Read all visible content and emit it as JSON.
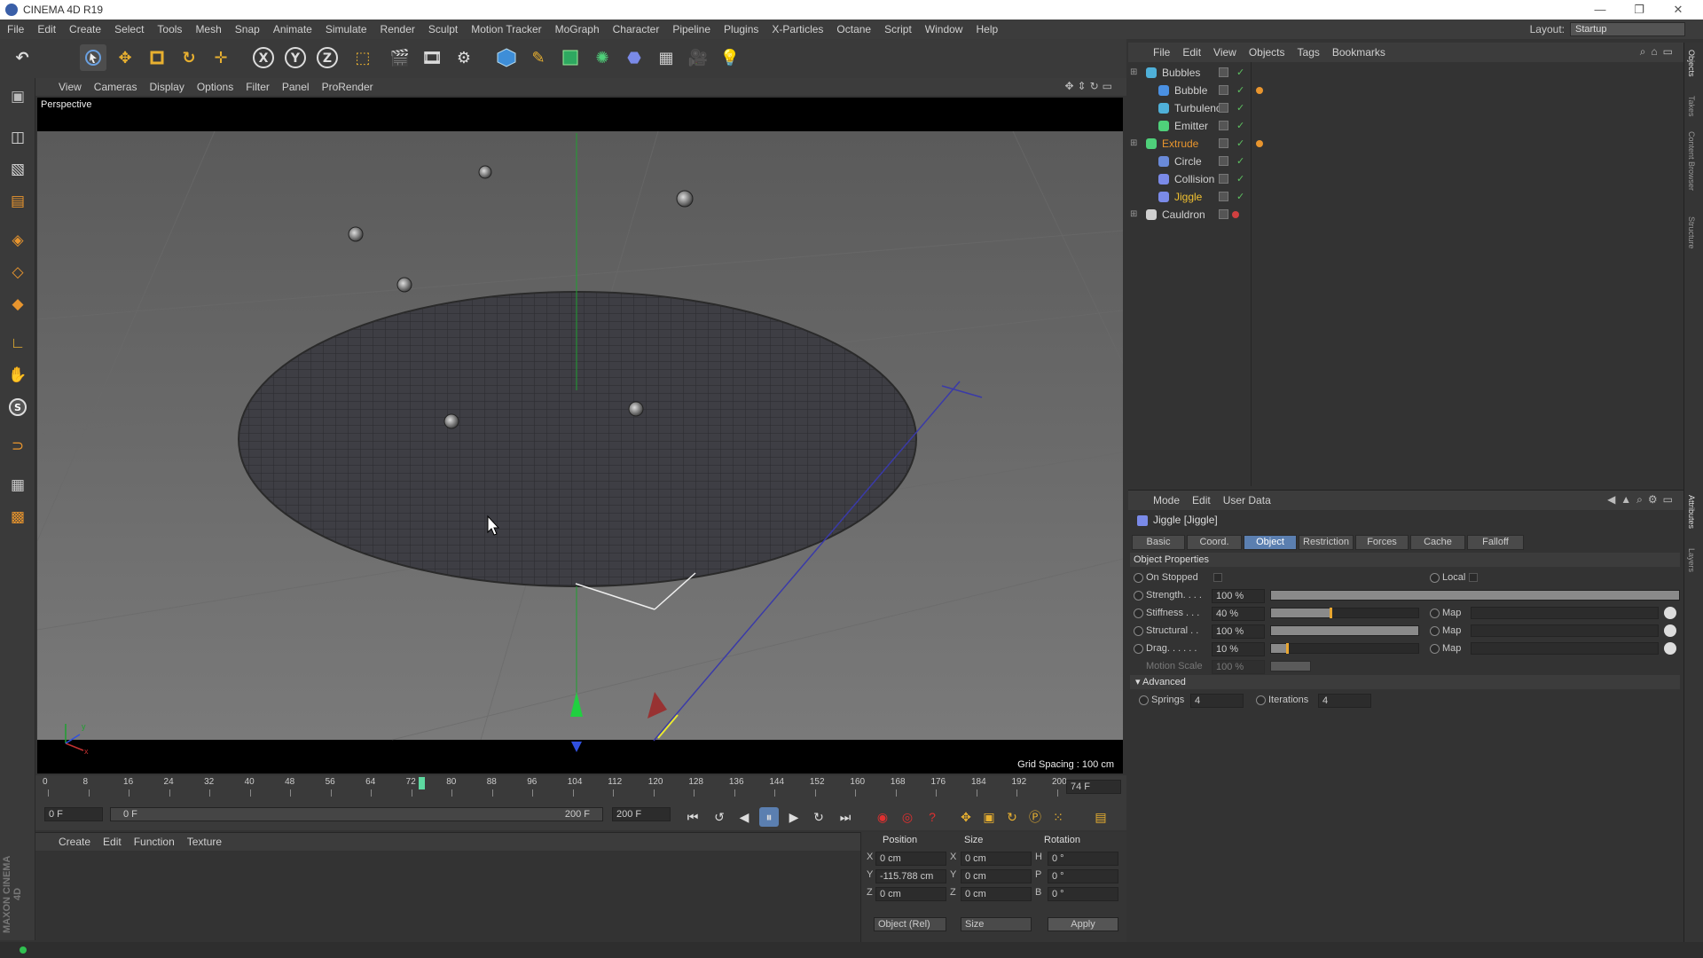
{
  "app": {
    "title": "CINEMA 4D R19",
    "window_controls": [
      "—",
      "❐",
      "✕"
    ]
  },
  "menubar": {
    "items": [
      "File",
      "Edit",
      "Create",
      "Select",
      "Tools",
      "Mesh",
      "Snap",
      "Animate",
      "Simulate",
      "Render",
      "Sculpt",
      "Motion Tracker",
      "MoGraph",
      "Character",
      "Pipeline",
      "Plugins",
      "X-Particles",
      "Octane",
      "Script",
      "Window",
      "Help"
    ],
    "layout_label": "Layout:",
    "layout_value": "Startup"
  },
  "viewport": {
    "menu": [
      "View",
      "Cameras",
      "Display",
      "Options",
      "Filter",
      "Panel",
      "ProRender"
    ],
    "label": "Perspective",
    "grid_spacing": "Grid Spacing : 100 cm",
    "axis_x": "x",
    "axis_y": "y"
  },
  "timeline": {
    "ticks": [
      "0",
      "8",
      "16",
      "24",
      "32",
      "40",
      "48",
      "56",
      "64",
      "72",
      "80",
      "88",
      "96",
      "104",
      "112",
      "120",
      "128",
      "136",
      "144",
      "152",
      "160",
      "168",
      "176",
      "184",
      "192",
      "200"
    ],
    "current_frame": "74 F",
    "start_field": "0 F",
    "range_start": "0 F",
    "range_end": "200 F",
    "end_field": "200 F"
  },
  "material_manager": {
    "menu": [
      "Create",
      "Edit",
      "Function",
      "Texture"
    ]
  },
  "coordinates": {
    "headers": [
      "Position",
      "Size",
      "Rotation"
    ],
    "rows": [
      {
        "axis": "X",
        "pos": "0 cm",
        "size_axis": "X",
        "size": "0 cm",
        "rot_axis": "H",
        "rot": "0 °"
      },
      {
        "axis": "Y",
        "pos": "-115.788 cm",
        "size_axis": "Y",
        "size": "0 cm",
        "rot_axis": "P",
        "rot": "0 °"
      },
      {
        "axis": "Z",
        "pos": "0 cm",
        "size_axis": "Z",
        "size": "0 cm",
        "rot_axis": "B",
        "rot": "0 °"
      }
    ],
    "mode_select": "Object (Rel)",
    "size_select": "Size",
    "apply_label": "Apply"
  },
  "object_manager": {
    "menu": [
      "File",
      "Edit",
      "View",
      "Objects",
      "Tags",
      "Bookmarks"
    ],
    "objects": [
      {
        "name": "Bubbles",
        "indent": 0,
        "color": "#d0d0d0",
        "icon_color": "#4fb0d8"
      },
      {
        "name": "Bubble",
        "indent": 1,
        "color": "#d0d0d0",
        "icon_color": "#4a90e2"
      },
      {
        "name": "Turbulence",
        "indent": 1,
        "color": "#d0d0d0",
        "icon_color": "#4fb0d8"
      },
      {
        "name": "Emitter",
        "indent": 1,
        "color": "#d0d0d0",
        "icon_color": "#4fd07a"
      },
      {
        "name": "Extrude",
        "indent": 0,
        "color": "#e8952e",
        "icon_color": "#4fd07a"
      },
      {
        "name": "Circle",
        "indent": 1,
        "color": "#d0d0d0",
        "icon_color": "#6a8ad8"
      },
      {
        "name": "Collision",
        "indent": 1,
        "color": "#d0d0d0",
        "icon_color": "#7a8ae8"
      },
      {
        "name": "Jiggle",
        "indent": 1,
        "color": "#f0c030",
        "icon_color": "#7a8ae8"
      },
      {
        "name": "Cauldron",
        "indent": 0,
        "color": "#d0d0d0",
        "icon_color": "#d0d0d0"
      }
    ]
  },
  "attribute_manager": {
    "menu": [
      "Mode",
      "Edit",
      "User Data"
    ],
    "object_title": "Jiggle [Jiggle]",
    "tabs": [
      "Basic",
      "Coord.",
      "Object",
      "Restriction",
      "Forces",
      "Cache",
      "Falloff"
    ],
    "active_tab": "Object",
    "section": "Object Properties",
    "on_stopped": "On Stopped",
    "local": "Local",
    "params": [
      {
        "label": "Strength. . . .",
        "value": "100 %",
        "level": 1.0,
        "has_map": false
      },
      {
        "label": "Stiffness . . .",
        "value": "40 %",
        "level": 0.4,
        "has_map": true
      },
      {
        "label": "Structural . .",
        "value": "100 %",
        "level": 1.0,
        "has_map": true
      },
      {
        "label": "Drag. . . . . .",
        "value": "10 %",
        "level": 0.1,
        "has_map": true
      }
    ],
    "map_label": "Map",
    "motion_scale": {
      "label": "Motion Scale",
      "value": "100 %"
    },
    "advanced": "Advanced",
    "springs": {
      "label": "Springs",
      "value": "4"
    },
    "iterations": {
      "label": "Iterations",
      "value": "4"
    }
  },
  "right_rail": [
    "Objects",
    "Takes",
    "Content Browser",
    "Structure",
    "Attributes",
    "Layers"
  ],
  "branding": "MAXON CINEMA 4D"
}
